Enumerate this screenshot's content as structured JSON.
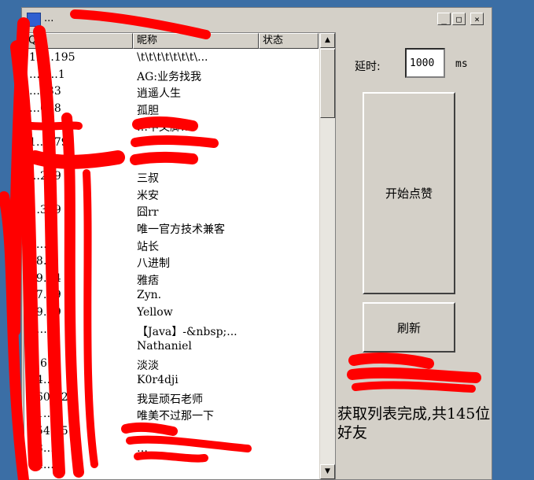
{
  "window": {
    "title": "...",
    "buttons": {
      "minimize": "_",
      "maximize": "□",
      "close": "×"
    }
  },
  "list": {
    "columns": [
      "QQ",
      "昵称",
      "状态"
    ],
    "rows": [
      {
        "qq": "12…195",
        "nick": "\\t\\t\\t\\t\\t\\t\\t\\..."
      },
      {
        "qq": "…3…1",
        "nick": "AG:业务找我"
      },
      {
        "qq": "…033",
        "nick": "逍遥人生"
      },
      {
        "qq": "…048",
        "nick": "孤胆"
      },
      {
        "qq": "",
        "nick": "…中文脚..."
      },
      {
        "qq": "1…279",
        "nick": ""
      },
      {
        "qq": "",
        "nick": ""
      },
      {
        "qq": "…229",
        "nick": "三叔"
      },
      {
        "qq": "",
        "nick": "米安"
      },
      {
        "qq": "…309",
        "nick": "囧rr"
      },
      {
        "qq": "",
        "nick": "唯一官方技术兼客"
      },
      {
        "qq": "1…",
        "nick": "站长"
      },
      {
        "qq": "18…",
        "nick": "八进制"
      },
      {
        "qq": "19…4",
        "nick": "雅痞"
      },
      {
        "qq": "27…9",
        "nick": "Zyn."
      },
      {
        "qq": "29…9",
        "nick": "Yellow"
      },
      {
        "qq": "3…",
        "nick": "【Java】-&nbsp;..."
      },
      {
        "qq": "",
        "nick": "Nathaniel"
      },
      {
        "qq": "…6",
        "nick": "淡淡"
      },
      {
        "qq": "44…",
        "nick": "K0r4dji"
      },
      {
        "qq": "460…2",
        "nick": "我是顽石老师"
      },
      {
        "qq": "51…1",
        "nick": "唯美不过那一下"
      },
      {
        "qq": "554…5",
        "nick": ""
      },
      {
        "qq": "58…5",
        "nick": "…"
      },
      {
        "qq": "64…1",
        "nick": ""
      }
    ]
  },
  "delay": {
    "label": "延时:",
    "value": "1000",
    "unit": "ms"
  },
  "buttons": {
    "start": "开始点赞",
    "refresh": "刷新"
  },
  "status": "获取列表完成,共145位好友",
  "scrollbar": {
    "up": "▲",
    "down": "▼"
  }
}
